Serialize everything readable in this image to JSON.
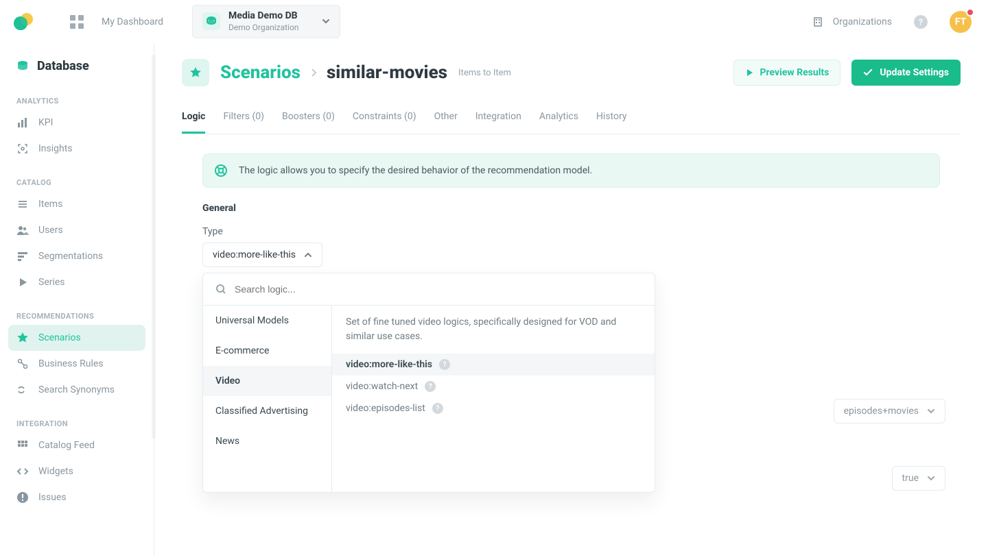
{
  "top": {
    "dashboard": "My Dashboard",
    "db_title": "Media Demo DB",
    "db_org": "Demo Organization",
    "organizations": "Organizations",
    "avatar_initials": "FT"
  },
  "sidebar": {
    "title": "Database",
    "groups": [
      {
        "label": "ANALYTICS",
        "items": [
          {
            "key": "kpi",
            "label": "KPI",
            "icon": "chart-bar"
          },
          {
            "key": "insights",
            "label": "Insights",
            "icon": "scan"
          }
        ]
      },
      {
        "label": "CATALOG",
        "items": [
          {
            "key": "items",
            "label": "Items",
            "icon": "list"
          },
          {
            "key": "users",
            "label": "Users",
            "icon": "people"
          },
          {
            "key": "segmentations",
            "label": "Segmentations",
            "icon": "segments"
          },
          {
            "key": "series",
            "label": "Series",
            "icon": "play"
          }
        ]
      },
      {
        "label": "RECOMMENDATIONS",
        "items": [
          {
            "key": "scenarios",
            "label": "Scenarios",
            "icon": "star",
            "active": true
          },
          {
            "key": "rules",
            "label": "Business Rules",
            "icon": "rules"
          },
          {
            "key": "synonyms",
            "label": "Search Synonyms",
            "icon": "approx"
          }
        ]
      },
      {
        "label": "INTEGRATION",
        "items": [
          {
            "key": "feed",
            "label": "Catalog Feed",
            "icon": "grid"
          },
          {
            "key": "widgets",
            "label": "Widgets",
            "icon": "code"
          },
          {
            "key": "issues",
            "label": "Issues",
            "icon": "alert"
          }
        ]
      }
    ]
  },
  "page": {
    "breadcrumb": {
      "root": "Scenarios",
      "current": "similar-movies",
      "subtitle": "Items to Item"
    },
    "actions": {
      "preview": "Preview Results",
      "update": "Update Settings"
    },
    "tabs": [
      {
        "key": "logic",
        "label": "Logic",
        "active": true
      },
      {
        "key": "filters",
        "label": "Filters (0)"
      },
      {
        "key": "boosters",
        "label": "Boosters (0)"
      },
      {
        "key": "constraints",
        "label": "Constraints (0)"
      },
      {
        "key": "other",
        "label": "Other"
      },
      {
        "key": "integration",
        "label": "Integration"
      },
      {
        "key": "analytics",
        "label": "Analytics"
      },
      {
        "key": "history",
        "label": "History"
      }
    ],
    "alert": "The logic allows you to specify the desired behavior of the recommendation model.",
    "general": {
      "title": "General",
      "type_label": "Type",
      "type_value": "video:more-like-this"
    },
    "dropdown": {
      "search_placeholder": "Search logic...",
      "categories": [
        {
          "key": "universal",
          "label": "Universal Models"
        },
        {
          "key": "ecom",
          "label": "E-commerce"
        },
        {
          "key": "video",
          "label": "Video",
          "active": true
        },
        {
          "key": "classified",
          "label": "Classified Advertising"
        },
        {
          "key": "news",
          "label": "News"
        }
      ],
      "panel": {
        "desc": "Set of fine tuned video logics, specifically designed for VOD and similar use cases.",
        "options": [
          {
            "key": "more",
            "label": "video:more-like-this",
            "selected": true
          },
          {
            "key": "watchnext",
            "label": "video:watch-next"
          },
          {
            "key": "episodes",
            "label": "video:episodes-list"
          }
        ]
      }
    },
    "right_selects": [
      {
        "value": "episodes+movies"
      },
      {
        "value": "true"
      }
    ]
  },
  "colors": {
    "teal": "#20c39e"
  }
}
